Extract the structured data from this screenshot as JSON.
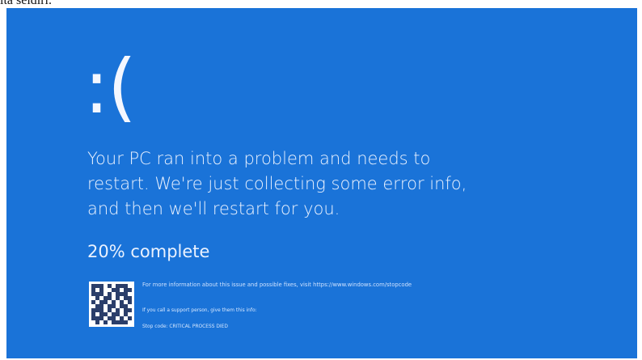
{
  "top_text": "ita seldiri.",
  "screen": {
    "sad_face": ":(",
    "message": "Your PC ran into a problem and needs to restart. We're just collecting some error info, and then we'll restart for you.",
    "progress": "20% complete",
    "more_info": "For more information about this issue and possible fixes, visit https://www.windows.com/stopcode",
    "support_hint": "If you call a support person, give them this info:",
    "stop_code": "Stop code: CRITICAL PROCESS DIED"
  },
  "colors": {
    "bsod_blue": "#1a73d8",
    "text": "#eaf2ff",
    "qr_dark": "#2b3e6a"
  }
}
